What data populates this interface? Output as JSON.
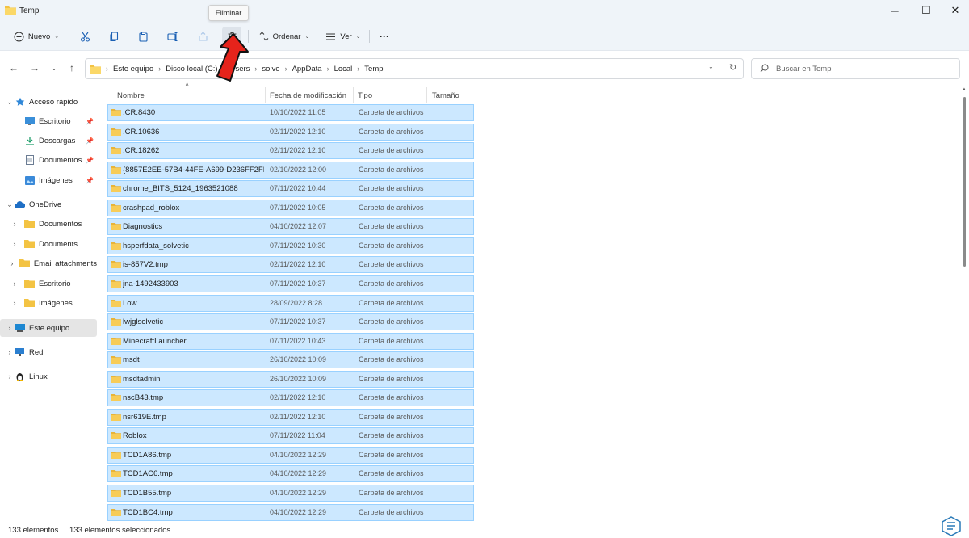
{
  "window": {
    "title": "Temp",
    "controls": {
      "minimize": "─",
      "maximize": "☐",
      "close": "✕"
    }
  },
  "toolbar": {
    "new_label": "Nuevo",
    "sort_label": "Ordenar",
    "view_label": "Ver",
    "more_label": "···",
    "tooltip": "Eliminar",
    "icons": [
      "cut-icon",
      "copy-icon",
      "paste-icon",
      "rename-icon",
      "share-icon",
      "delete-icon"
    ]
  },
  "address": {
    "crumbs": [
      "Este equipo",
      "Disco local (C:)",
      "Users",
      "solve",
      "AppData",
      "Local",
      "Temp"
    ],
    "search_placeholder": "Buscar en Temp"
  },
  "sidebar": {
    "items": [
      {
        "label": "Acceso rápido",
        "icon": "star-icon",
        "pinned": false
      },
      {
        "label": "Escritorio",
        "icon": "desktop-icon",
        "pinned": true
      },
      {
        "label": "Descargas",
        "icon": "download-icon",
        "pinned": true
      },
      {
        "label": "Documentos",
        "icon": "documents-icon",
        "pinned": true
      },
      {
        "label": "Imágenes",
        "icon": "images-icon",
        "pinned": true
      },
      {
        "label": "OneDrive",
        "icon": "cloud-icon",
        "pinned": false
      },
      {
        "label": "Documentos",
        "icon": "folder-icon",
        "pinned": false
      },
      {
        "label": "Documents",
        "icon": "folder-icon",
        "pinned": false
      },
      {
        "label": "Email attachments",
        "icon": "folder-icon",
        "pinned": false
      },
      {
        "label": "Escritorio",
        "icon": "folder-icon",
        "pinned": false
      },
      {
        "label": "Imágenes",
        "icon": "folder-icon",
        "pinned": false
      },
      {
        "label": "Este equipo",
        "icon": "computer-icon",
        "pinned": false
      },
      {
        "label": "Red",
        "icon": "network-icon",
        "pinned": false
      },
      {
        "label": "Linux",
        "icon": "linux-icon",
        "pinned": false
      }
    ]
  },
  "columns": {
    "name": "Nombre",
    "date": "Fecha de modificación",
    "type": "Tipo",
    "size": "Tamaño"
  },
  "files": [
    {
      "name": ".CR.8430",
      "date": "10/10/2022 11:05",
      "type": "Carpeta de archivos"
    },
    {
      "name": ".CR.10636",
      "date": "02/11/2022 12:10",
      "type": "Carpeta de archivos"
    },
    {
      "name": ".CR.18262",
      "date": "02/11/2022 12:10",
      "type": "Carpeta de archivos"
    },
    {
      "name": "{8857E2EE-57B4-44FE-A699-D236FF2FDEE...",
      "date": "02/10/2022 12:00",
      "type": "Carpeta de archivos"
    },
    {
      "name": "chrome_BITS_5124_1963521088",
      "date": "07/11/2022 10:44",
      "type": "Carpeta de archivos"
    },
    {
      "name": "crashpad_roblox",
      "date": "07/11/2022 10:05",
      "type": "Carpeta de archivos"
    },
    {
      "name": "Diagnostics",
      "date": "04/10/2022 12:07",
      "type": "Carpeta de archivos"
    },
    {
      "name": "hsperfdata_solvetic",
      "date": "07/11/2022 10:30",
      "type": "Carpeta de archivos"
    },
    {
      "name": "is-857V2.tmp",
      "date": "02/11/2022 12:10",
      "type": "Carpeta de archivos"
    },
    {
      "name": "jna-1492433903",
      "date": "07/11/2022 10:37",
      "type": "Carpeta de archivos"
    },
    {
      "name": "Low",
      "date": "28/09/2022 8:28",
      "type": "Carpeta de archivos"
    },
    {
      "name": "lwjglsolvetic",
      "date": "07/11/2022 10:37",
      "type": "Carpeta de archivos"
    },
    {
      "name": "MinecraftLauncher",
      "date": "07/11/2022 10:43",
      "type": "Carpeta de archivos"
    },
    {
      "name": "msdt",
      "date": "26/10/2022 10:09",
      "type": "Carpeta de archivos"
    },
    {
      "name": "msdtadmin",
      "date": "26/10/2022 10:09",
      "type": "Carpeta de archivos"
    },
    {
      "name": "nscB43.tmp",
      "date": "02/11/2022 12:10",
      "type": "Carpeta de archivos"
    },
    {
      "name": "nsr619E.tmp",
      "date": "02/11/2022 12:10",
      "type": "Carpeta de archivos"
    },
    {
      "name": "Roblox",
      "date": "07/11/2022 11:04",
      "type": "Carpeta de archivos"
    },
    {
      "name": "TCD1A86.tmp",
      "date": "04/10/2022 12:29",
      "type": "Carpeta de archivos"
    },
    {
      "name": "TCD1AC6.tmp",
      "date": "04/10/2022 12:29",
      "type": "Carpeta de archivos"
    },
    {
      "name": "TCD1B55.tmp",
      "date": "04/10/2022 12:29",
      "type": "Carpeta de archivos"
    },
    {
      "name": "TCD1BC4.tmp",
      "date": "04/10/2022 12:29",
      "type": "Carpeta de archivos"
    }
  ],
  "status": {
    "count": "133 elementos",
    "selected": "133 elementos seleccionados"
  },
  "colors": {
    "selection_fill": "#cce8ff",
    "selection_border": "#99d1ff",
    "folder": "#f3c343",
    "accent": "#1a5fb4"
  }
}
